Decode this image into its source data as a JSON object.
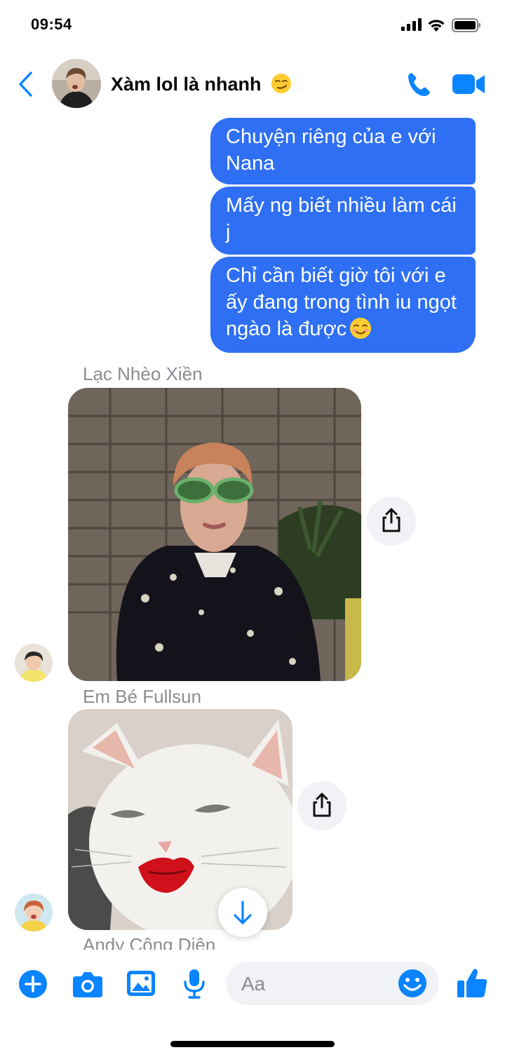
{
  "status_bar": {
    "time": "09:54"
  },
  "header": {
    "title": "Xàm lol là nhanh"
  },
  "messages": [
    {
      "from": "me",
      "text": "Chuyện riêng của e với Nana"
    },
    {
      "from": "me",
      "text": "Mấy ng biết nhiều làm cái j"
    },
    {
      "from": "me",
      "text": "Chỉ cần biết giờ tôi với e ấy đang trong tình iu ngọt ngào là được"
    }
  ],
  "senders": [
    "Lạc Nhèo Xiền",
    "Em Bé Fullsun",
    "Andy Công Diện"
  ],
  "composer": {
    "placeholder": "Aa"
  },
  "colors": {
    "accent": "#0a84ff",
    "bubble": "#2e6ff3",
    "muted": "#8a8d91"
  },
  "icons": [
    "back-chevron-icon",
    "phone-icon",
    "video-icon",
    "share-icon",
    "arrow-down-icon",
    "plus-icon",
    "camera-icon",
    "gallery-icon",
    "microphone-icon",
    "emoji-icon",
    "thumbs-up-icon"
  ]
}
